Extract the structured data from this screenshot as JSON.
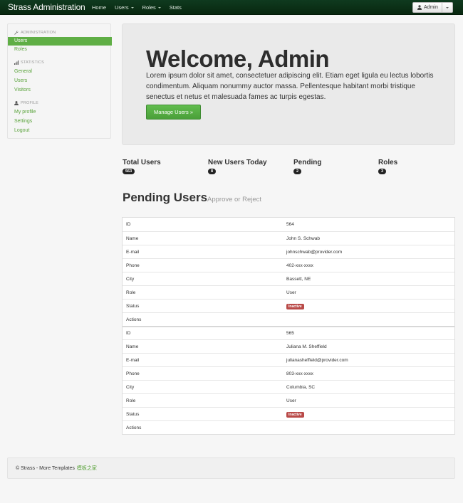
{
  "navbar": {
    "brand": "Strass Administration",
    "items": [
      "Home",
      "Users",
      "Roles",
      "Stats"
    ],
    "user_button": "Admin"
  },
  "sidebar": {
    "administration_header": "ADMINISTRATION",
    "administration_items": [
      "Users",
      "Roles"
    ],
    "statistics_header": "STATISTICS",
    "statistics_items": [
      "General",
      "Users",
      "Visitors"
    ],
    "profile_header": "PROFILE",
    "profile_items": [
      "My profile",
      "Settings",
      "Logout"
    ]
  },
  "hero": {
    "title": "Welcome, Admin",
    "text": "Lorem ipsum dolor sit amet, consectetuer adipiscing elit. Etiam eget ligula eu lectus lobortis condimentum. Aliquam nonummy auctor massa. Pellentesque habitant morbi tristique senectus et netus et malesuada fames ac turpis egestas.",
    "button": "Manage Users »"
  },
  "stats": [
    {
      "label": "Total Users",
      "value": "563"
    },
    {
      "label": "New Users Today",
      "value": "8"
    },
    {
      "label": "Pending",
      "value": "2"
    },
    {
      "label": "Roles",
      "value": "3"
    }
  ],
  "pending": {
    "title": "Pending Users",
    "subtitle": "Approve or Reject",
    "field_labels": [
      "ID",
      "Name",
      "E-mail",
      "Phone",
      "City",
      "Role",
      "Status",
      "Actions"
    ],
    "users": [
      {
        "id": "564",
        "name": "John S. Schwab",
        "email": "johnschwab@provider.com",
        "phone": "402-xxx-xxxx",
        "city": "Bassett, NE",
        "role": "User",
        "status": "Inactive"
      },
      {
        "id": "565",
        "name": "Juliana M. Sheffield",
        "email": "julianasheffield@provider.com",
        "phone": "803-xxx-xxxx",
        "city": "Columbia, SC",
        "role": "User",
        "status": "Inactive"
      }
    ]
  },
  "footer": {
    "text": "© Strass - More Templates",
    "link": "模板之家"
  },
  "colors": {
    "navbar": "#0f3a1f",
    "accent": "#5fae45",
    "link": "#5aa33b",
    "inactive": "#b94a48"
  }
}
